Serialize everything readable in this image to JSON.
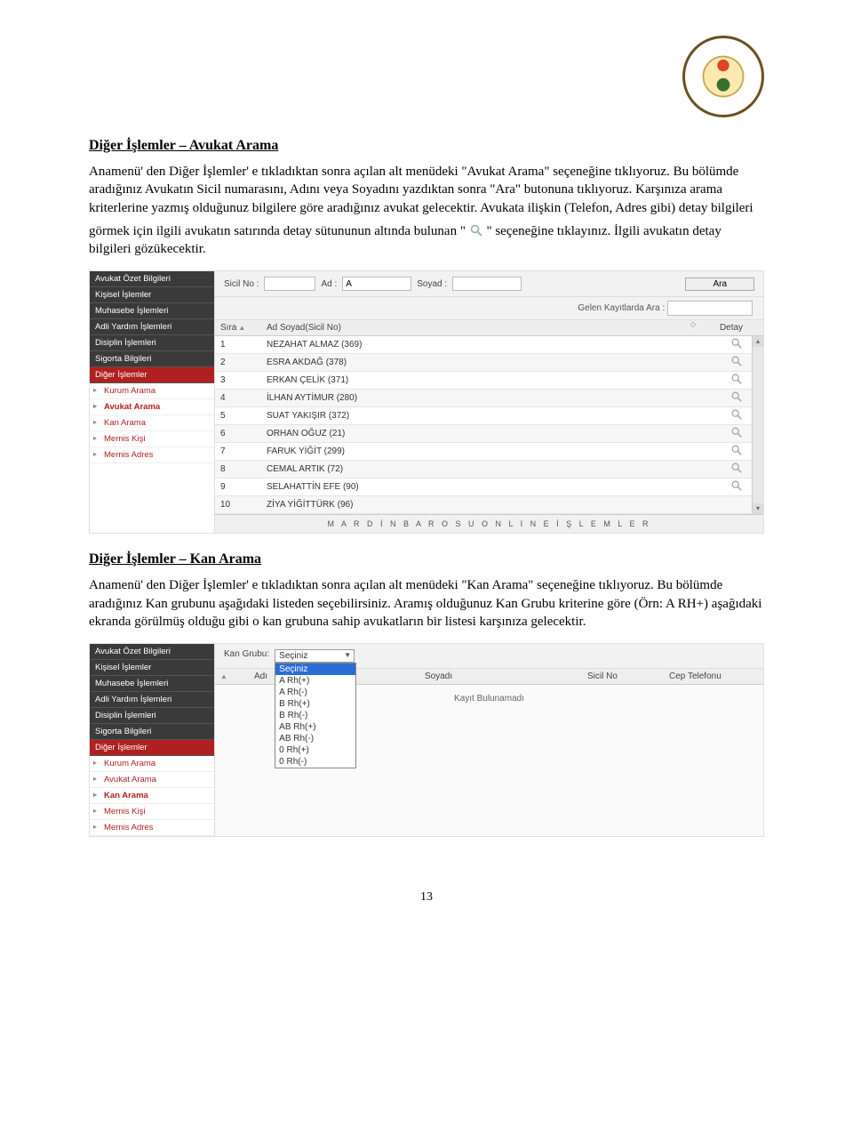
{
  "section1": {
    "title": "Diğer İşlemler – Avukat Arama",
    "p1": "Anamenü' den Diğer İşlemler' e tıkladıktan sonra açılan alt menüdeki \"Avukat Arama\" seçeneğine tıklıyoruz. Bu bölümde aradığınız Avukatın Sicil numarasını, Adını veya Soyadını yazdıktan sonra \"Ara\" butonuna tıklıyoruz. Karşınıza arama kriterlerine yazmış olduğunuz bilgilere göre aradığınız avukat gelecektir. Avukata ilişkin (Telefon, Adres gibi) detay bilgileri",
    "p2_before": "görmek için ilgili avukatın satırında detay sütununun altında bulunan \"",
    "p2_after": "\" seçeneğine tıklayınız. İlgili avukatın detay bilgileri gözükecektir."
  },
  "sidebar": {
    "heads": [
      "Avukat Özet Bilgileri",
      "Kişisel İşlemler",
      "Muhasebe İşlemleri",
      "Adli Yardım İşlemleri",
      "Disiplin İşlemleri",
      "Sigorta Bilgileri"
    ],
    "active": "Diğer İşlemler",
    "subs": [
      "Kurum Arama",
      "Avukat Arama",
      "Kan Arama",
      "Mernis Kişi",
      "Mernis Adres"
    ]
  },
  "shot1": {
    "labels": {
      "sicil": "Sicil No :",
      "ad": "Ad :",
      "ad_val": "A",
      "soyad": "Soyad :",
      "ara": "Ara",
      "filter": "Gelen Kayıtlarda Ara :"
    },
    "head": {
      "sira": "Sıra",
      "name": "Ad Soyad(Sicil No)",
      "detay": "Detay"
    },
    "rows": [
      {
        "n": "1",
        "name": "NEZAHAT ALMAZ (369)"
      },
      {
        "n": "2",
        "name": "ESRA AKDAĞ (378)"
      },
      {
        "n": "3",
        "name": "ERKAN ÇELİK (371)"
      },
      {
        "n": "4",
        "name": "İLHAN AYTİMUR (280)"
      },
      {
        "n": "5",
        "name": "SUAT YAKIŞIR (372)"
      },
      {
        "n": "6",
        "name": "ORHAN OĞUZ (21)"
      },
      {
        "n": "7",
        "name": "FARUK YİĞİT (299)"
      },
      {
        "n": "8",
        "name": "CEMAL ARTIK (72)"
      },
      {
        "n": "9",
        "name": "SELAHATTİN EFE (90)"
      },
      {
        "n": "10",
        "name": "ZİYA YİĞİTTÜRK (96)"
      }
    ],
    "footer": "M A R D İ N   B A R O S U   O N L I N E   İ Ş L E M L E R"
  },
  "section2": {
    "title": "Diğer İşlemler – Kan Arama",
    "p": "Anamenü' den Diğer İşlemler' e tıkladıktan sonra açılan alt menüdeki \"Kan Arama\" seçeneğine tıklıyoruz. Bu bölümde aradığınız Kan grubunu aşağıdaki listeden seçebilirsiniz. Aramış olduğunuz Kan Grubu kriterine göre (Örn: A RH+) aşağıdaki ekranda görülmüş olduğu gibi o kan grubuna sahip avukatların bir listesi karşınıza gelecektir."
  },
  "shot2": {
    "kan_label": "Kan Grubu:",
    "selected": "Seçiniz",
    "options": [
      "Seçiniz",
      "A Rh(+)",
      "A Rh(-)",
      "B Rh(+)",
      "B Rh(-)",
      "AB Rh(+)",
      "AB Rh(-)",
      "0 Rh(+)",
      "0 Rh(-)"
    ],
    "head": {
      "adi": "Adı",
      "soy": "Soyadı",
      "sicil": "Sicil No",
      "cep": "Cep Telefonu"
    },
    "norecord": "Kayıt Bulunamadı"
  },
  "page_number": "13"
}
